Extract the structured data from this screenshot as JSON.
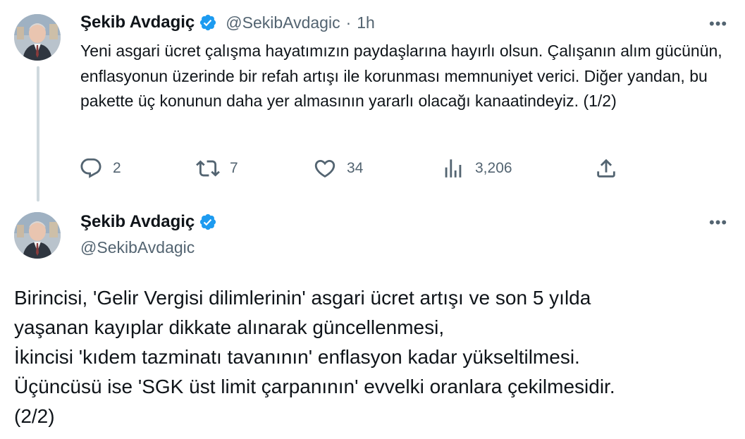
{
  "tweet1": {
    "author_name": "Şekib Avdagiç",
    "handle": "@SekibAvdagic",
    "separator": "·",
    "time": "1h",
    "text": "Yeni asgari ücret çalışma hayatımızın paydaşlarına hayırlı olsun. Çalışanın alım gücünün, enflasyonun üzerinde bir refah artışı ile korunması memnuniyet verici. Diğer yandan, bu pakette üç konunun daha yer almasının yararlı olacağı kanaatindeyiz. (1/2)",
    "replies": "2",
    "reposts": "7",
    "likes": "34",
    "views": "3,206",
    "more": "•••"
  },
  "tweet2": {
    "author_name": "Şekib Avdagiç",
    "handle": "@SekibAvdagic",
    "text": "Birincisi, 'Gelir Vergisi dilimlerinin' asgari ücret artışı ve son 5 yılda\nyaşanan kayıplar dikkate alınarak güncellenmesi,\nİkincisi 'kıdem tazminatı tavanının' enflasyon kadar yükseltilmesi.\nÜçüncüsü ise 'SGK üst limit çarpanının' evvelki oranlara çekilmesidir.\n(2/2)",
    "more": "•••"
  },
  "icons": {
    "reply": "reply-icon",
    "repost": "repost-icon",
    "like": "like-icon",
    "views": "views-icon",
    "share": "share-icon",
    "verified": "verified-badge-icon"
  },
  "colors": {
    "verified": "#1d9bf0",
    "text": "#0f1419",
    "secondary": "#536471",
    "thread_line": "#cfd9de"
  }
}
